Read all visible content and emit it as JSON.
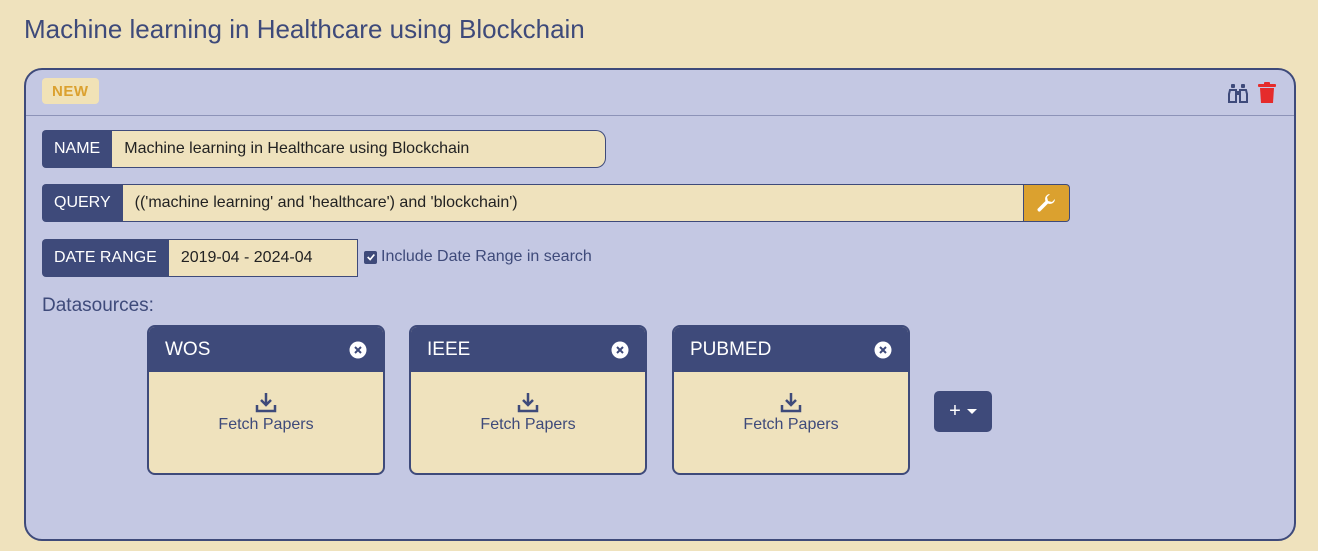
{
  "page": {
    "title": "Machine learning in Healthcare using Blockchain"
  },
  "card": {
    "badge": "NEW",
    "icons": [
      "binoculars-icon",
      "trash-icon"
    ],
    "colors": {
      "accent": "#dba12f",
      "primary": "#3e4a7a",
      "danger": "#e52b2b",
      "background": "#efe2bd",
      "panel": "#c4c8e3"
    }
  },
  "form": {
    "name_label": "NAME",
    "name_value": "Machine learning in Healthcare using Blockchain",
    "query_label": "QUERY",
    "query_value": "(('machine learning' and 'healthcare') and 'blockchain')",
    "date_label": "DATE RANGE",
    "date_value": "2019-04 - 2024-04",
    "include_date_label": "Include Date Range in search",
    "include_date_checked": true
  },
  "datasources": {
    "label": "Datasources:",
    "items": [
      {
        "name": "WOS",
        "action": "Fetch Papers"
      },
      {
        "name": "IEEE",
        "action": "Fetch Papers"
      },
      {
        "name": "PUBMED",
        "action": "Fetch Papers"
      }
    ],
    "add_label": "+"
  }
}
